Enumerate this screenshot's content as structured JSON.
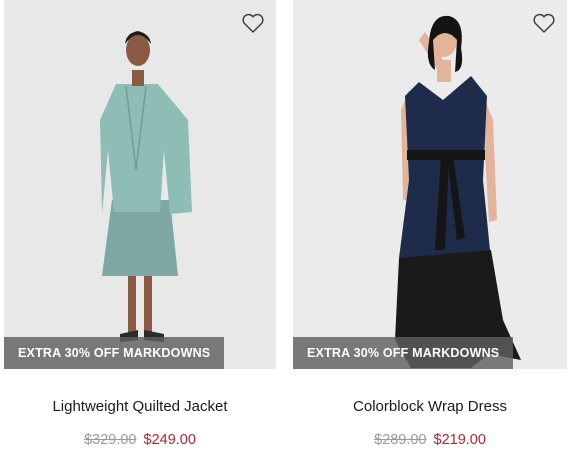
{
  "colors": {
    "accent_price": "#b5242d",
    "strike_price": "#9a9a9a",
    "promo_bg": "#5f5f5f"
  },
  "products": [
    {
      "name": "Lightweight Quilted Jacket",
      "promo": "EXTRA 30% OFF MARKDOWNS",
      "original_price": "$329.00",
      "sale_price": "$249.00",
      "favorite_icon": "heart-outline-icon",
      "favorited": false
    },
    {
      "name": "Colorblock Wrap Dress",
      "promo": "EXTRA 30% OFF MARKDOWNS",
      "original_price": "$289.00",
      "sale_price": "$219.00",
      "favorite_icon": "heart-outline-icon",
      "favorited": false
    }
  ]
}
